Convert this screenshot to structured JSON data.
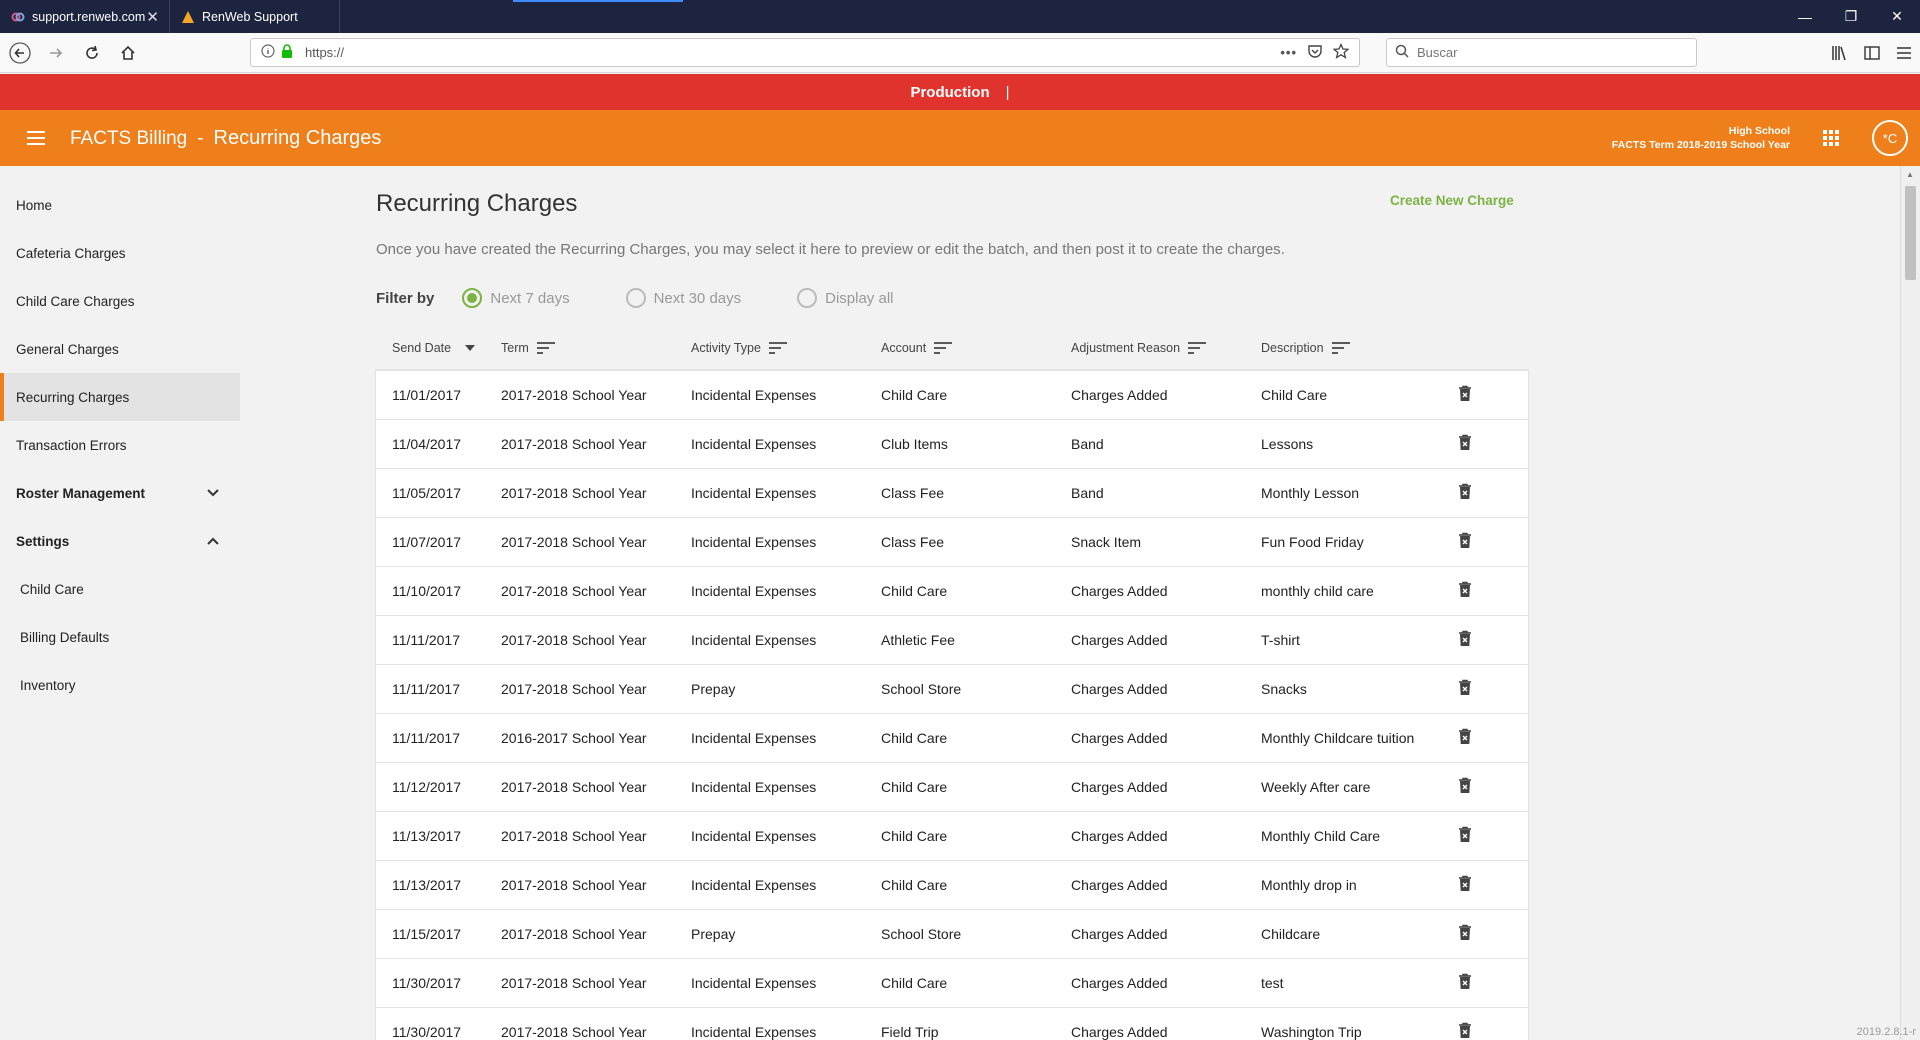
{
  "browser": {
    "tabs": [
      {
        "title": "support.renweb.com",
        "icon": "renweb-swirl-icon"
      },
      {
        "title": "RenWeb Support",
        "icon": "renweb-logo-icon"
      }
    ],
    "url": "https://",
    "search_placeholder": "Buscar"
  },
  "banner": {
    "label": "Production",
    "separator": "|"
  },
  "header": {
    "app_name": "FACTS Billing",
    "dash": "-",
    "page": "Recurring Charges",
    "school": "High School",
    "term": "FACTS Term 2018-2019 School Year",
    "avatar": "*C",
    "color": "#ef7f1a"
  },
  "sidebar": {
    "items": [
      {
        "label": "Home"
      },
      {
        "label": "Cafeteria Charges"
      },
      {
        "label": "Child Care Charges"
      },
      {
        "label": "General Charges"
      },
      {
        "label": "Recurring Charges"
      },
      {
        "label": "Transaction Errors"
      },
      {
        "label": "Roster Management"
      },
      {
        "label": "Settings"
      },
      {
        "label": "Child Care"
      },
      {
        "label": "Billing Defaults"
      },
      {
        "label": "Inventory"
      }
    ]
  },
  "main": {
    "title": "Recurring Charges",
    "create_label": "Create New Charge",
    "description": "Once you have created the Recurring Charges, you may select it here to preview or edit the batch, and then post it to create the charges.",
    "filter": {
      "label": "Filter by",
      "options": [
        "Next 7 days",
        "Next 30 days",
        "Display all"
      ],
      "selected": "Next 7 days"
    },
    "columns": [
      "Send Date",
      "Term",
      "Activity Type",
      "Account",
      "Adjustment Reason",
      "Description"
    ],
    "rows": [
      {
        "date": "11/01/2017",
        "term": "2017-2018 School Year",
        "activity": "Incidental Expenses",
        "account": "Child Care",
        "reason": "Charges Added",
        "desc": "Child Care"
      },
      {
        "date": "11/04/2017",
        "term": "2017-2018 School Year",
        "activity": "Incidental Expenses",
        "account": "Club Items",
        "reason": "Band",
        "desc": "Lessons"
      },
      {
        "date": "11/05/2017",
        "term": "2017-2018 School Year",
        "activity": "Incidental Expenses",
        "account": "Class Fee",
        "reason": "Band",
        "desc": "Monthly Lesson"
      },
      {
        "date": "11/07/2017",
        "term": "2017-2018 School Year",
        "activity": "Incidental Expenses",
        "account": "Class Fee",
        "reason": "Snack Item",
        "desc": "Fun Food Friday"
      },
      {
        "date": "11/10/2017",
        "term": "2017-2018 School Year",
        "activity": "Incidental Expenses",
        "account": "Child Care",
        "reason": "Charges Added",
        "desc": "monthly child care"
      },
      {
        "date": "11/11/2017",
        "term": "2017-2018 School Year",
        "activity": "Incidental Expenses",
        "account": "Athletic Fee",
        "reason": "Charges Added",
        "desc": "T-shirt"
      },
      {
        "date": "11/11/2017",
        "term": "2017-2018 School Year",
        "activity": "Prepay",
        "account": "School Store",
        "reason": "Charges Added",
        "desc": "Snacks"
      },
      {
        "date": "11/11/2017",
        "term": "2016-2017 School Year",
        "activity": "Incidental Expenses",
        "account": "Child Care",
        "reason": "Charges Added",
        "desc": "Monthly Childcare tuition"
      },
      {
        "date": "11/12/2017",
        "term": "2017-2018 School Year",
        "activity": "Incidental Expenses",
        "account": "Child Care",
        "reason": "Charges Added",
        "desc": "Weekly After care"
      },
      {
        "date": "11/13/2017",
        "term": "2017-2018 School Year",
        "activity": "Incidental Expenses",
        "account": "Child Care",
        "reason": "Charges Added",
        "desc": "Monthly Child Care"
      },
      {
        "date": "11/13/2017",
        "term": "2017-2018 School Year",
        "activity": "Incidental Expenses",
        "account": "Child Care",
        "reason": "Charges Added",
        "desc": "Monthly drop in"
      },
      {
        "date": "11/15/2017",
        "term": "2017-2018 School Year",
        "activity": "Prepay",
        "account": "School Store",
        "reason": "Charges Added",
        "desc": "Childcare"
      },
      {
        "date": "11/30/2017",
        "term": "2017-2018 School Year",
        "activity": "Incidental Expenses",
        "account": "Child Care",
        "reason": "Charges Added",
        "desc": "test"
      },
      {
        "date": "11/30/2017",
        "term": "2017-2018 School Year",
        "activity": "Incidental Expenses",
        "account": "Field Trip",
        "reason": "Charges Added",
        "desc": "Washington Trip"
      }
    ]
  },
  "version": "2019.2.8.1-r"
}
